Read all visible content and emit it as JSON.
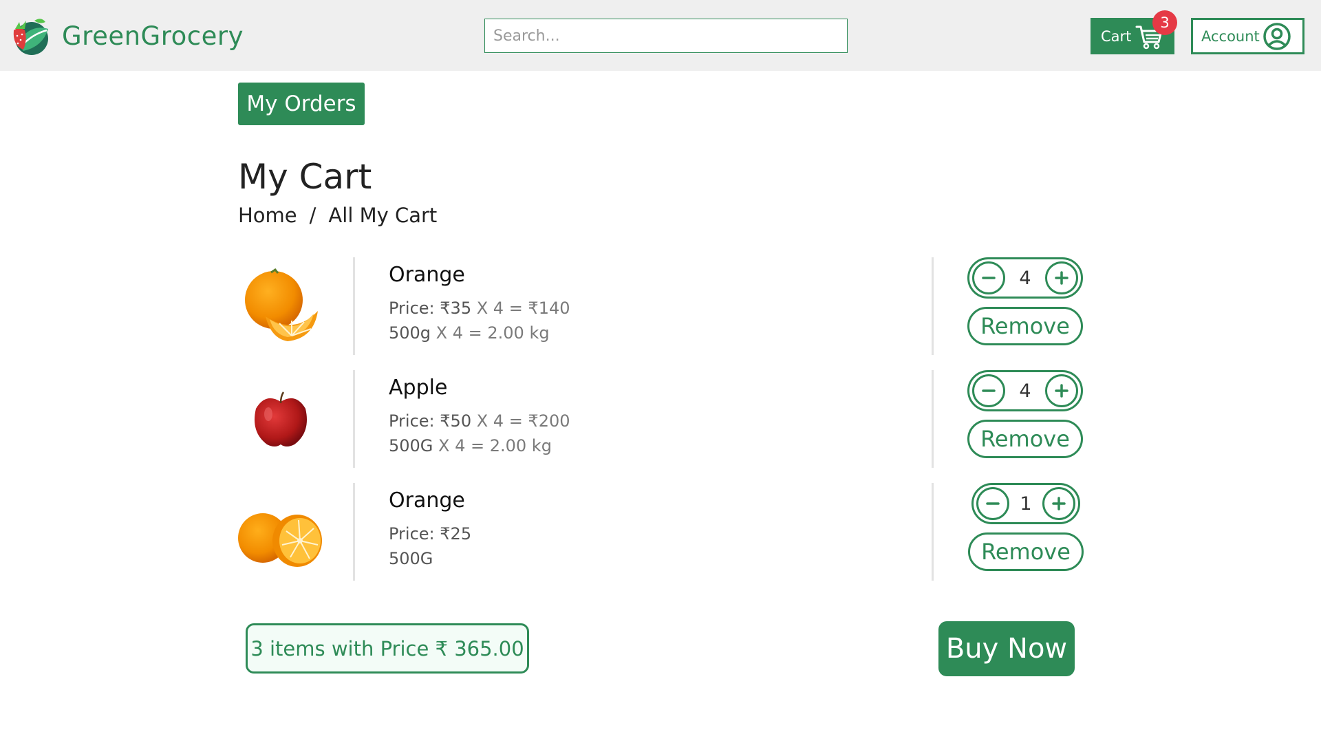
{
  "brand": {
    "name": "GreenGrocery",
    "logo_icon": "strawberry-leaf-logo-icon"
  },
  "header": {
    "search": {
      "placeholder": "Search..."
    },
    "cart": {
      "label": "Cart",
      "count": "3",
      "icon": "cart-icon"
    },
    "account": {
      "label": "Account",
      "icon": "user-circle-icon"
    }
  },
  "page": {
    "orders_button": "My Orders",
    "title": "My Cart",
    "breadcrumb": {
      "home": "Home",
      "separator": "/",
      "current": "All My Cart"
    }
  },
  "cart_items": [
    {
      "name": "Orange",
      "price_label": "Price:",
      "price": "₹35",
      "price_calc": " X 4 = ₹140",
      "weight": "500g",
      "weight_calc": " X 4 = 2.00 kg",
      "quantity": "4",
      "remove_label": "Remove",
      "image": "orange-with-slice"
    },
    {
      "name": "Apple",
      "price_label": "Price:",
      "price": "₹50",
      "price_calc": " X 4 = ₹200",
      "weight": "500G",
      "weight_calc": " X 4 = 2.00 kg",
      "quantity": "4",
      "remove_label": "Remove",
      "image": "red-apple"
    },
    {
      "name": "Orange",
      "price_label": "Price:",
      "price": "₹25",
      "price_calc": "",
      "weight": "500G",
      "weight_calc": "",
      "quantity": "1",
      "remove_label": "Remove",
      "image": "orange-halves"
    }
  ],
  "summary": {
    "text": "3 items with Price ₹ 365.00"
  },
  "buy_button": "Buy Now",
  "colors": {
    "accent": "#2e8b57",
    "badge": "#e53945",
    "header_bg": "#efefef"
  }
}
